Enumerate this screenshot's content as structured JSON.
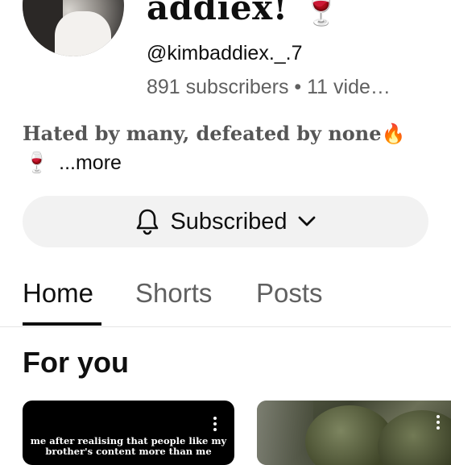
{
  "channel": {
    "name": "addiex! 🍷",
    "handle": "@kimbaddiex._.7",
    "stats": "891 subscribers • 11 vide…",
    "description_line1": "Hated by many, defeated by none🔥",
    "description_line2_emoji": "🍷",
    "more_label": "...more"
  },
  "subscribe": {
    "label": "Subscribed",
    "bell_icon": "bell-icon",
    "chevron_icon": "chevron-down-icon"
  },
  "tabs": [
    {
      "label": "Home",
      "active": true
    },
    {
      "label": "Shorts",
      "active": false
    },
    {
      "label": "Posts",
      "active": false
    }
  ],
  "section": {
    "title": "For you"
  },
  "videos": [
    {
      "caption": "me after realising that people like my brother's content more than me"
    }
  ]
}
